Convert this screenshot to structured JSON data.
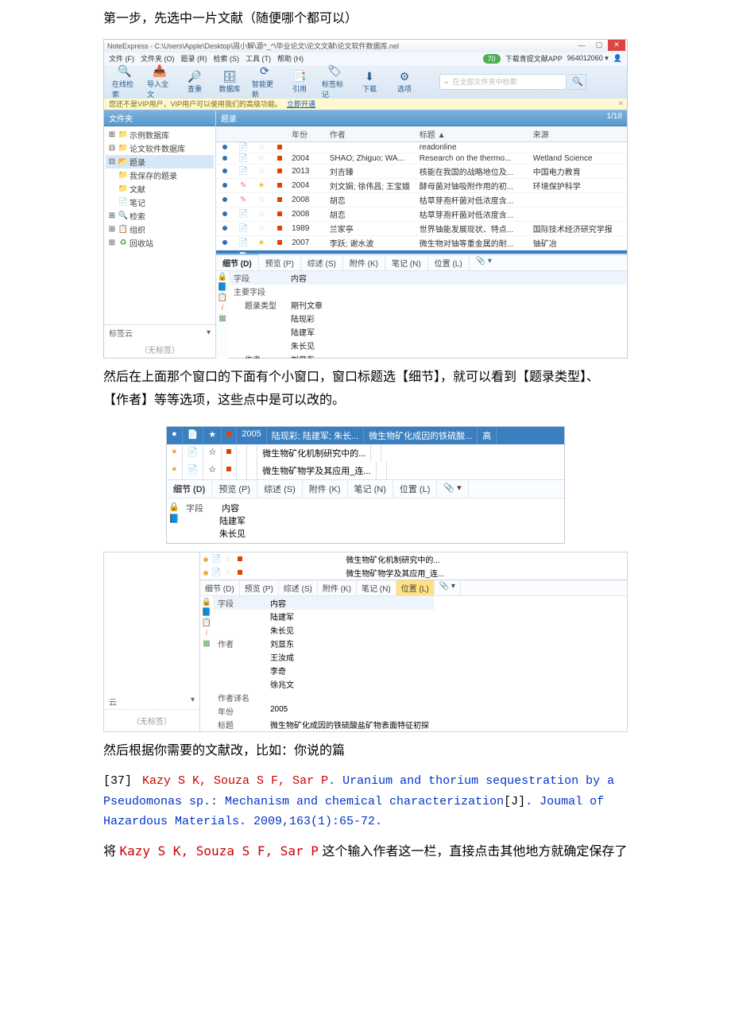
{
  "doc": {
    "step1": "第一步，先选中一片文献（随便哪个都可以）",
    "para2a": "然后在上面那个窗口的下面有个小窗口，窗口标题选【细节】，就可以看到【题录类型】、",
    "para2b": "【作者】等等选项，这些点中是可以改的。",
    "para3": "然后根据你需要的文献改，比如：你说的篇",
    "ref_no": "[37]",
    "ref_authors": "Kazy S K, Souza S F, Sar P",
    "ref_title": ". Uranium and thorium sequestration by a Pseudomonas sp.: Mechanism and chemical characterization",
    "ref_type": "[J]",
    "ref_tail": ". Joumal of Hazardous Materials. 2009,163(1):65-72.",
    "para4a": "将 ",
    "para4b": " 这个输入作者这一栏，直接点击其他地方就确定保存了"
  },
  "app": {
    "title": "NoteExpress - C:\\Users\\Apple\\Desktop\\周小解\\源^_^\\毕业论文\\论文文献\\论文软件数据库.nel",
    "menu": [
      "文件 (F)",
      "文件夹 (O)",
      "题录 (R)",
      "检索 (S)",
      "工具 (T)",
      "帮助 (H)"
    ],
    "rt": {
      "app": "下载青提文献APP",
      "id": "964012060 ▾",
      "badge": "70"
    },
    "toolbar": [
      {
        "icon": "🔍",
        "label": "在线检索"
      },
      {
        "icon": "📥",
        "label": "导入全文"
      },
      {
        "icon": "🔎",
        "label": "查重"
      },
      {
        "icon": "🗄",
        "label": "数据库"
      },
      {
        "icon": "⟳",
        "label": "智能更新"
      },
      {
        "icon": "📑",
        "label": "引用"
      },
      {
        "icon": "🏷",
        "label": "标签标记"
      },
      {
        "icon": "⬇",
        "label": "下载"
      },
      {
        "icon": "⚙",
        "label": "选项"
      }
    ],
    "search_placeholder": "在全部文件夹中检索",
    "yellowbar": {
      "msg": "您还不是VIP用户，VIP用户可以使用我们的高级功能。",
      "link": "立即开通"
    },
    "sidebar": {
      "hdr": "文件夹",
      "items": [
        {
          "ind": 0,
          "icon": "📁",
          "cls": "fold-blue",
          "label": "示例数据库",
          "pre": "⊞"
        },
        {
          "ind": 0,
          "icon": "📁",
          "cls": "fold-blue",
          "label": "论文软件数据库",
          "pre": "⊟"
        },
        {
          "ind": 1,
          "icon": "📂",
          "cls": "fold-blue",
          "label": "题录",
          "pre": "⊟",
          "sel": true
        },
        {
          "ind": 2,
          "icon": "📁",
          "cls": "fold-yellow",
          "label": "我保存的题录"
        },
        {
          "ind": 2,
          "icon": "📁",
          "cls": "fold-yellow",
          "label": "文献"
        },
        {
          "ind": 1,
          "icon": "📄",
          "cls": "fold-blue",
          "label": "笔记"
        },
        {
          "ind": 1,
          "icon": "🔍",
          "cls": "fold-blue",
          "label": "检索",
          "pre": "⊞"
        },
        {
          "ind": 1,
          "icon": "📋",
          "cls": "fold-blue",
          "label": "组织",
          "pre": "⊞"
        },
        {
          "ind": 1,
          "icon": "♻",
          "cls": "fold-green",
          "label": "回收站",
          "pre": "⊞"
        }
      ],
      "tag_hdr": "标签云",
      "tag_none": "（无标签）"
    },
    "grid": {
      "hdr": "题录",
      "count": "1/18",
      "cols": [
        "",
        "",
        "",
        "",
        "年份",
        "作者",
        "标题 ▲",
        "来源"
      ],
      "rows": [
        {
          "c0": "b",
          "c1": "doc",
          "c2": "g",
          "c3": "r",
          "year": "",
          "author": "",
          "title": "readonline",
          "src": ""
        },
        {
          "c0": "b",
          "c1": "doc",
          "c2": "g",
          "c3": "r",
          "year": "2004",
          "author": "SHAO; Zhiguo; WA...",
          "title": "Research on the thermo...",
          "src": "Wetland Science"
        },
        {
          "c0": "b",
          "c1": "doc",
          "c2": "g",
          "c3": "r",
          "year": "2013",
          "author": "刘吉臻",
          "title": "核能在我国的战略地位及...",
          "src": "中国电力教育"
        },
        {
          "c0": "b",
          "c1": "pen",
          "c2": "s",
          "c3": "r",
          "year": "2004",
          "author": "刘文娟; 徐伟昌; 王宝娥",
          "title": "酵母菌对铀吸附作用的初...",
          "src": "环境保护科学"
        },
        {
          "c0": "b",
          "c1": "pen",
          "c2": "g",
          "c3": "r",
          "year": "2008",
          "author": "胡恋",
          "title": "枯草芽孢杆菌对低浓度含...",
          "src": ""
        },
        {
          "c0": "b",
          "c1": "doc",
          "c2": "g",
          "c3": "r",
          "year": "2008",
          "author": "胡恋",
          "title": "枯草芽孢杆菌对低浓度含...",
          "src": ""
        },
        {
          "c0": "b",
          "c1": "doc",
          "c2": "g",
          "c3": "r",
          "year": "1989",
          "author": "兰家亭",
          "title": "世界铀能发展现状、特点...",
          "src": "国际技术经济研究学报"
        },
        {
          "c0": "b",
          "c1": "doc",
          "c2": "s",
          "c3": "r",
          "year": "2007",
          "author": "李跃; 谢水波",
          "title": "微生物对铀等重金属的耐...",
          "src": "铀矿冶"
        },
        {
          "c0": "b",
          "c1": "doc",
          "c2": "S",
          "c3": "r",
          "year": "2005",
          "author": "陆现彩; 陆建军; 朱长...",
          "title": "微生物矿化成因的铁硫酸...",
          "src": "高校地质学报",
          "sel": true
        },
        {
          "c0": "o",
          "c1": "doc",
          "c2": "g",
          "c3": "r",
          "year": "",
          "author": "",
          "title": "微生物矿化机制研究中的...",
          "src": ""
        },
        {
          "c0": "o",
          "c1": "doc",
          "c2": "g",
          "c3": "r",
          "year": "",
          "author": "",
          "title": "微生物矿物学及其应用_连...",
          "src": ""
        }
      ]
    },
    "detail": {
      "tabs": [
        "细节 (D)",
        "预览 (P)",
        "综述 (S)",
        "附件 (K)",
        "笔记 (N)",
        "位置 (L)"
      ],
      "clip": "📎 ▾",
      "col_field": "字段",
      "col_content": "内容",
      "rows": [
        {
          "k": "主要字段",
          "v": ""
        },
        {
          "k": "题录类型",
          "v": "期刊文章",
          "ind": 1
        },
        {
          "k": "",
          "v": "陆现彩"
        },
        {
          "k": "",
          "v": "陆建军"
        },
        {
          "k": "",
          "v": "朱长见"
        },
        {
          "k": "作者",
          "v": "刘显东",
          "ind": 1
        },
        {
          "k": "",
          "v": "王汝成"
        },
        {
          "k": "",
          "v": "李奇"
        },
        {
          "k": "",
          "v": "徐兆文"
        }
      ]
    }
  },
  "shot2": {
    "r0": [
      "",
      "📄",
      "★",
      "",
      "2005",
      "陆现彩; 陆建军; 朱长...",
      "微生物矿化成因的铁硫酸...",
      "高"
    ],
    "r1": [
      "●",
      "📄",
      "☆",
      "",
      "",
      "",
      "微生物矿化机制研究中的...",
      ""
    ],
    "r2": [
      "●",
      "📄",
      "☆",
      "",
      "",
      "",
      "微生物矿物学及其应用_连...",
      ""
    ],
    "tabs": [
      "细节 (D)",
      "预览 (P)",
      "综述 (S)",
      "附件 (K)",
      "笔记 (N)",
      "位置 (L)"
    ],
    "clip": "📎 ▾",
    "k_field": "字段",
    "k_content": "内容",
    "vals": [
      "陆建军",
      "朱长见"
    ]
  },
  "shot3": {
    "left_hdr": "云",
    "tag_none": "（无标签）",
    "mini_rows": [
      {
        "dot": "o",
        "title": "微生物矿化机制研究中的..."
      },
      {
        "dot": "o",
        "title": "微生物矿物学及其应用_连..."
      }
    ],
    "tabs": [
      "细节 (D)",
      "预览 (P)",
      "综述 (S)",
      "附件 (K)",
      "笔记 (N)",
      "位置 (L)"
    ],
    "clip": "📎 ▾",
    "rows": [
      {
        "k": "字段",
        "v": "内容",
        "hdr": true
      },
      {
        "k": "",
        "v": "陆建军"
      },
      {
        "k": "",
        "v": "朱长见"
      },
      {
        "k": "作者",
        "v": "刘显东"
      },
      {
        "k": "",
        "v": "王汝成"
      },
      {
        "k": "",
        "v": "李奇"
      },
      {
        "k": "",
        "v": "徐兆文"
      },
      {
        "k": "作者译名",
        "v": ""
      },
      {
        "k": "年份",
        "v": "2005"
      },
      {
        "k": "标题",
        "v": "微生物矿化成因的铁硫酸盐矿物表面特征初探"
      }
    ]
  }
}
